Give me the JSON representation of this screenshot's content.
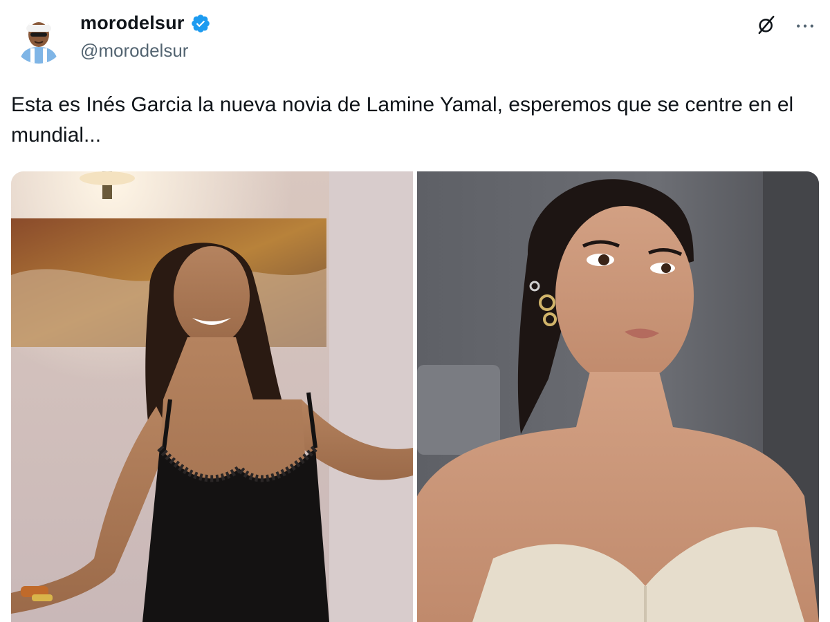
{
  "post": {
    "author": {
      "display_name": "morodelsur",
      "handle": "@morodelsur",
      "verified": true,
      "badge_color": "#1d9bf0"
    },
    "text": "Esta es Inés Garcia la nueva novia de Lamine Yamal, esperemos que se centre en el mundial...",
    "actions": {
      "grok_icon": "grok-icon",
      "more_icon": "more-icon",
      "more_label": "···"
    },
    "media": [
      {
        "icon": "photo-1"
      },
      {
        "icon": "photo-2"
      }
    ]
  },
  "colors": {
    "text": "#0f1419",
    "secondary": "#536471",
    "verified_blue": "#1d9bf0"
  }
}
